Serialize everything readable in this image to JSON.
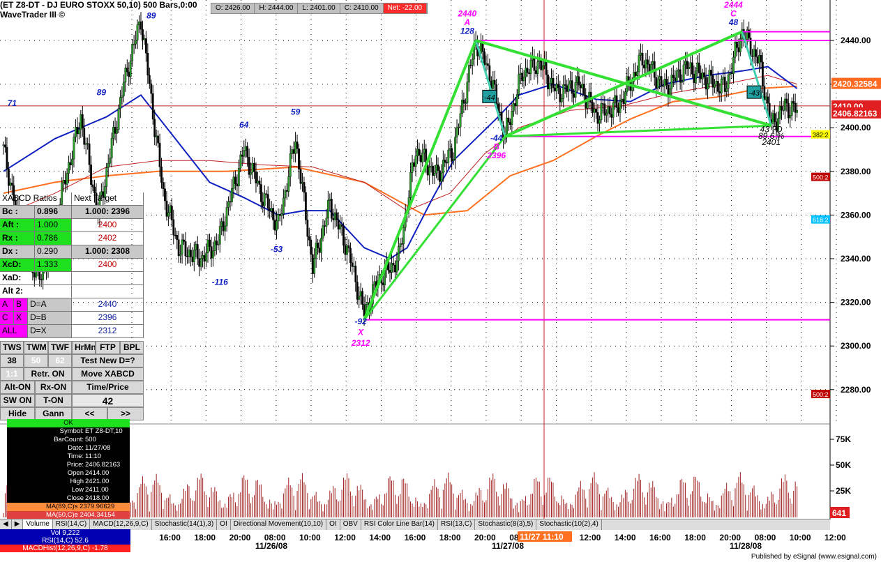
{
  "window": {
    "title": "(ET Z8-DT - DJ EURO STOXX 50,10) 500 Bars,0:00",
    "subtitle": "WaveTrader III ©"
  },
  "quote_bar": {
    "open": "O: 2426.00",
    "high": "H: 2444.00",
    "low": "L: 2401.00",
    "close": "C: 2410.00",
    "net": "Net: -22.00"
  },
  "chart_data": {
    "type": "candlestick",
    "y_range": [
      2260,
      2450
    ],
    "price_ticks": [
      "2440.00",
      "2420.00",
      "2400.00",
      "2380.00",
      "2360.00",
      "2340.00",
      "2320.00",
      "2300.00",
      "2280.00"
    ],
    "price_labels": [
      {
        "text": "2420.32584",
        "price": 2420.33,
        "color": "#ff6a20"
      },
      {
        "text": "2410.00",
        "price": 2410.0,
        "color": "#e02020"
      },
      {
        "text": "2406.82163",
        "price": 2406.82,
        "color": "#e02020"
      }
    ],
    "right_side_tags": [
      {
        "text": "382:2",
        "price": 2397,
        "color": "#ffff00"
      },
      {
        "text": "500:2",
        "price": 2377.5,
        "color": "#c00000"
      },
      {
        "text": "618:2",
        "price": 2358,
        "color": "#00c0ff"
      },
      {
        "text": "500:2",
        "price": 2278,
        "color": "#c00000"
      }
    ],
    "time_labels": [
      "00",
      "16:00",
      "18:00",
      "20:00",
      "08:00",
      "10:00",
      "12:00",
      "14:00",
      "16:00",
      "18:00",
      "20:00",
      "08:00",
      "10:00",
      "12:00",
      "14:00",
      "16:00",
      "18:00",
      "20:00",
      "08:00",
      "10:00",
      "12:00"
    ],
    "date_labels": [
      "11/26/08",
      "11/27/08",
      "11/28/08"
    ],
    "cursor_time": "11/27 11:10",
    "volume_ticks": [
      "75K",
      "50K",
      "25K"
    ],
    "volume_last": "641",
    "anchors": [
      {
        "idx": 0,
        "p": 2390
      },
      {
        "idx": 12,
        "p": 2345
      },
      {
        "idx": 22,
        "p": 2330
      },
      {
        "idx": 34,
        "p": 2370
      },
      {
        "idx": 45,
        "p": 2405
      },
      {
        "idx": 55,
        "p": 2360
      },
      {
        "idx": 70,
        "p": 2420
      },
      {
        "idx": 80,
        "p": 2450
      },
      {
        "idx": 93,
        "p": 2370
      },
      {
        "idx": 102,
        "p": 2345
      },
      {
        "idx": 115,
        "p": 2340
      },
      {
        "idx": 125,
        "p": 2348
      },
      {
        "idx": 140,
        "p": 2390
      },
      {
        "idx": 150,
        "p": 2370
      },
      {
        "idx": 160,
        "p": 2355
      },
      {
        "idx": 170,
        "p": 2395
      },
      {
        "idx": 180,
        "p": 2336
      },
      {
        "idx": 190,
        "p": 2365
      },
      {
        "idx": 200,
        "p": 2345
      },
      {
        "idx": 210,
        "p": 2315
      },
      {
        "idx": 218,
        "p": 2330
      },
      {
        "idx": 230,
        "p": 2340
      },
      {
        "idx": 240,
        "p": 2390
      },
      {
        "idx": 252,
        "p": 2378
      },
      {
        "idx": 262,
        "p": 2390
      },
      {
        "idx": 275,
        "p": 2440
      },
      {
        "idx": 283,
        "p": 2425
      },
      {
        "idx": 292,
        "p": 2396
      },
      {
        "idx": 302,
        "p": 2425
      },
      {
        "idx": 312,
        "p": 2430
      },
      {
        "idx": 322,
        "p": 2416
      },
      {
        "idx": 335,
        "p": 2420
      },
      {
        "idx": 345,
        "p": 2406
      },
      {
        "idx": 358,
        "p": 2410
      },
      {
        "idx": 372,
        "p": 2432
      },
      {
        "idx": 385,
        "p": 2418
      },
      {
        "idx": 398,
        "p": 2428
      },
      {
        "idx": 410,
        "p": 2422
      },
      {
        "idx": 420,
        "p": 2418
      },
      {
        "idx": 430,
        "p": 2444
      },
      {
        "idx": 440,
        "p": 2430
      },
      {
        "idx": 447,
        "p": 2401
      },
      {
        "idx": 455,
        "p": 2410
      },
      {
        "idx": 462,
        "p": 2408
      }
    ],
    "ma_blue": [
      [
        0,
        2380
      ],
      [
        30,
        2395
      ],
      [
        60,
        2405
      ],
      [
        80,
        2415
      ],
      [
        100,
        2395
      ],
      [
        120,
        2375
      ],
      [
        140,
        2368
      ],
      [
        160,
        2360
      ],
      [
        175,
        2362
      ],
      [
        190,
        2362
      ],
      [
        210,
        2345
      ],
      [
        225,
        2340
      ],
      [
        235,
        2345
      ],
      [
        250,
        2368
      ],
      [
        262,
        2385
      ],
      [
        275,
        2395
      ],
      [
        288,
        2405
      ],
      [
        300,
        2415
      ],
      [
        320,
        2420
      ],
      [
        345,
        2413
      ],
      [
        365,
        2412
      ],
      [
        385,
        2420
      ],
      [
        410,
        2424
      ],
      [
        430,
        2426
      ],
      [
        445,
        2428
      ],
      [
        462,
        2418
      ]
    ],
    "ma_red": [
      [
        0,
        2360
      ],
      [
        30,
        2370
      ],
      [
        60,
        2382
      ],
      [
        90,
        2385
      ],
      [
        120,
        2385
      ],
      [
        150,
        2383
      ],
      [
        180,
        2382
      ],
      [
        210,
        2375
      ],
      [
        235,
        2362
      ],
      [
        260,
        2370
      ],
      [
        280,
        2388
      ],
      [
        300,
        2400
      ],
      [
        330,
        2408
      ],
      [
        360,
        2410
      ],
      [
        390,
        2416
      ],
      [
        420,
        2420
      ],
      [
        445,
        2424
      ],
      [
        462,
        2420
      ]
    ],
    "ma_orange": [
      [
        0,
        2370
      ],
      [
        30,
        2375
      ],
      [
        60,
        2378
      ],
      [
        90,
        2380
      ],
      [
        130,
        2380
      ],
      [
        170,
        2382
      ],
      [
        210,
        2375
      ],
      [
        245,
        2360
      ],
      [
        270,
        2362
      ],
      [
        295,
        2378
      ],
      [
        320,
        2385
      ],
      [
        345,
        2396
      ],
      [
        365,
        2404
      ],
      [
        390,
        2412
      ],
      [
        415,
        2414
      ],
      [
        440,
        2418
      ],
      [
        462,
        2419
      ]
    ],
    "xabcd_1": {
      "x": [
        210,
        2312
      ],
      "a": [
        275,
        2440
      ],
      "b": [
        292,
        2396
      ],
      "c": [
        430,
        2444
      ],
      "d": [
        447,
        2401
      ]
    },
    "xabcd_2": {
      "x": [
        275,
        2440
      ],
      "a": [
        292,
        2396
      ],
      "b": [
        430,
        2444
      ],
      "c": [
        447,
        2401
      ]
    },
    "horizontal_levels": [
      2444,
      2440,
      2396,
      2312
    ],
    "red_level": 2410,
    "annotations": [
      {
        "text": "89",
        "idx": 86,
        "p": 2450,
        "color": "blue"
      },
      {
        "text": "89",
        "idx": 57,
        "p": 2415,
        "color": "blue"
      },
      {
        "text": "71",
        "idx": 5,
        "p": 2410,
        "color": "blue"
      },
      {
        "text": "64",
        "idx": 140,
        "p": 2400,
        "color": "blue"
      },
      {
        "text": "59",
        "idx": 170,
        "p": 2406,
        "color": "blue"
      },
      {
        "text": "-116",
        "idx": 126,
        "p": 2328,
        "color": "blue"
      },
      {
        "text": "-53",
        "idx": 159,
        "p": 2343,
        "color": "blue"
      },
      {
        "text": "-92",
        "idx": 208,
        "p": 2310,
        "color": "blue"
      },
      {
        "text": "X",
        "idx": 208,
        "p": 2305,
        "color": "magenta"
      },
      {
        "text": "2312",
        "idx": 208,
        "p": 2300,
        "color": "magenta"
      },
      {
        "text": "2440",
        "idx": 270,
        "p": 2451,
        "color": "magenta"
      },
      {
        "text": "A",
        "idx": 270,
        "p": 2447,
        "color": "magenta"
      },
      {
        "text": "128",
        "idx": 270,
        "p": 2443,
        "color": "blue"
      },
      {
        "text": "-44",
        "idx": 287,
        "p": 2394,
        "color": "blue"
      },
      {
        "text": "B",
        "idx": 287,
        "p": 2390,
        "color": "magenta"
      },
      {
        "text": "2396",
        "idx": 287,
        "p": 2386,
        "color": "magenta"
      },
      {
        "text": "2444",
        "idx": 425,
        "p": 2455,
        "color": "magenta"
      },
      {
        "text": "C",
        "idx": 425,
        "p": 2451,
        "color": "magenta"
      },
      {
        "text": "48",
        "idx": 425,
        "p": 2447,
        "color": "blue"
      },
      {
        "text": "43 ?D",
        "idx": 447,
        "p": 2398,
        "color": "black"
      },
      {
        "text": "89.6 %",
        "idx": 447,
        "p": 2395,
        "color": "black"
      },
      {
        "text": "2401",
        "idx": 447,
        "p": 2392,
        "color": "black"
      }
    ],
    "retracement_boxes": [
      {
        "text": "-44",
        "idx": 283,
        "p": 2414
      },
      {
        "text": "-43",
        "idx": 437,
        "p": 2416
      }
    ]
  },
  "panel": {
    "header": "XABCD Ratios",
    "next_target": "Next Target",
    "rows": [
      {
        "k": "Bc :",
        "v": "0.896",
        "t": "1.000: 2396"
      },
      {
        "k": "Aft :",
        "v": "1.000",
        "t": "2400"
      },
      {
        "k": "Rx :",
        "v": "0.786",
        "t": "2402"
      },
      {
        "k": "Dx :",
        "v": "0.290",
        "t": "1.000: 2308"
      },
      {
        "k": "XcD:",
        "v": "1.333",
        "t": "2400"
      },
      {
        "k": "XaD:",
        "v": "",
        "t": ""
      },
      {
        "k": "Alt 2:",
        "v": "",
        "t": ""
      }
    ],
    "targets": [
      {
        "a": "A",
        "b": "B",
        "eq": "D=A",
        "v": "2440"
      },
      {
        "a": "C",
        "b": "X",
        "eq": "D=B",
        "v": "2396"
      },
      {
        "a": "ALL",
        "b": "",
        "eq": "D=X",
        "v": "2312"
      }
    ],
    "tabs": [
      "TWS",
      "TWM",
      "TWF",
      "HrMn",
      "FTP",
      "BPL"
    ],
    "tab_values": [
      "38",
      "50",
      "62"
    ],
    "test_new": "Test New D=?",
    "ratio": "1:1",
    "retr": "Retr. ON",
    "move": "Move XABCD",
    "alt_on": "Alt-ON",
    "rx_on": "Rx-ON",
    "time_price": "Time/Price",
    "sw_on": "SW ON",
    "t_on": "T-ON",
    "count": "42",
    "hide": "Hide",
    "gann": "Gann",
    "prev": "<<",
    "next": ">>"
  },
  "tooltip": {
    "status": "OK",
    "lines": [
      {
        "k": "Symbol:",
        "v": "ET Z8-DT,10"
      },
      {
        "k": "BarCount:",
        "v": "500"
      },
      {
        "k": "Date:",
        "v": "11/27/08"
      },
      {
        "k": "Time:",
        "v": "11:10"
      },
      {
        "k": "Price:",
        "v": "2406.82163"
      },
      {
        "k": "Open",
        "v": "2414.00"
      },
      {
        "k": "High",
        "v": "2421.00"
      },
      {
        "k": "Low",
        "v": "2411.00"
      },
      {
        "k": "Close",
        "v": "2418.00"
      }
    ],
    "ma1": "MA(89,C)s  2379.96629",
    "ma2": "MA(50,C)e  2404.34154"
  },
  "indicator_tabs": [
    "Volume",
    "RSI(14,C)",
    "MACD(12,26,9,C)",
    "Stochastic(14(1),3)",
    "OI",
    "Directional Movement(10,10)",
    "OI",
    "OBV",
    "RSI Color Line Bar(14)",
    "RSI(13,C)",
    "Stochastic(8(3),5)",
    "Stochastic(10(2),4)"
  ],
  "indicator_values": [
    "Vol 9,222",
    "RSI(14,C) 52.6",
    "MACDHist(12,26,9,C) -1.78"
  ],
  "publisher": "Published by eSignal (www.esignal.com)",
  "colors": {
    "green": "#33e033",
    "magenta": "#ff00ff",
    "blue": "#1020c0",
    "red": "#c02020",
    "orange": "#ff7020",
    "teal": "#40d0b0"
  }
}
